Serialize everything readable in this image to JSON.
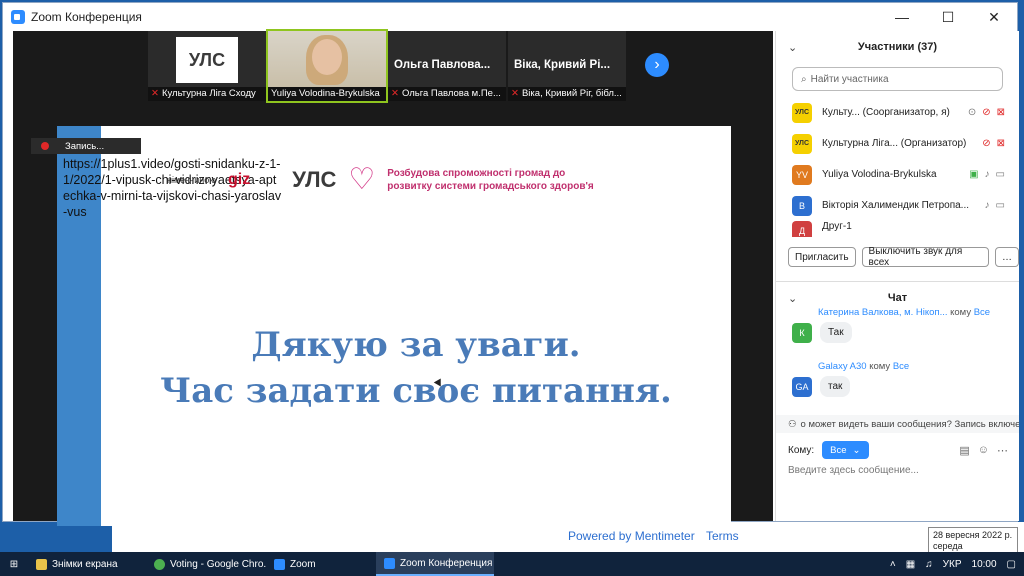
{
  "window": {
    "title": "Zoom Конференция",
    "minimize": "—",
    "maximize": "☐",
    "close": "✕"
  },
  "thumbnails": [
    {
      "name": "Культурна Ліга Сходу",
      "logo_text": "УЛС"
    },
    {
      "name": "Yuliya Volodina-Brykulska"
    },
    {
      "big_name": "Ольга Павлова...",
      "name": "Ольга Павлова м.Пе..."
    },
    {
      "big_name": "Віка, Кривий Рі...",
      "name": "Віка, Кривий Ріг, бібл..."
    }
  ],
  "recording": {
    "label": "Запись..."
  },
  "slide": {
    "url": "https://1plus1.video/gosti-snidanku-z-1-1/2022/1-vipusk-chi-vidriznyaetsya-aptechka-v-mirni-ta-vijskovi-chasi-yaroslav-vus",
    "partner_text": "німеччиною",
    "giz": "giz",
    "logo_text": "УЛС",
    "project_title": "Розбудова спроможності громад до розвитку системи громадського здоров'я",
    "line1": "Дякую за уваги.",
    "line2": "Час задати своє питання."
  },
  "participants_panel": {
    "header": "Участники (37)",
    "search_placeholder": "Найти участника",
    "items": [
      {
        "initials": "УЛС",
        "name": "Культу... (Соорганизатор, я)",
        "color": "#f5d000"
      },
      {
        "initials": "УЛС",
        "name": "Культурна Ліга... (Организатор)",
        "color": "#f5d000"
      },
      {
        "initials": "YV",
        "name": "Yuliya Volodina-Brykulska",
        "color": "#e07a1f"
      },
      {
        "initials": "В",
        "name": "Вікторія Халимендик Петропа...",
        "color": "#2d6fd0"
      },
      {
        "initials": "Д",
        "name": "Друг-1",
        "color": "#d04040"
      }
    ],
    "invite_button": "Пригласить",
    "mute_all_button": "Выключить звук для всех",
    "more_button": "…"
  },
  "chat": {
    "header": "Чат",
    "messages": [
      {
        "from": "Катерина Валкова, м. Нікоп...",
        "to_prefix": "кому",
        "to": "Все",
        "initial": "К",
        "text": "Так",
        "color": "#3fb04a"
      },
      {
        "from": "Galaxy A30",
        "to_prefix": "кому",
        "to": "Все",
        "initial": "GA",
        "text": "так",
        "color": "#2d6fd0"
      }
    ],
    "notice": "о может видеть ваши сообщения? Запись включе",
    "to_label": "Кому:",
    "to_value": "Все",
    "input_placeholder": "Введите здесь сообщение..."
  },
  "mentimeter": {
    "powered": "Powered by Mentimeter",
    "terms": "Terms"
  },
  "date_tooltip": {
    "date": "28 вересня 2022 р.",
    "day": "середа"
  },
  "taskbar": {
    "items": [
      {
        "label": "Знімки екрана",
        "color": "#e8c34a"
      },
      {
        "label": "Voting - Google Chro...",
        "color": "#4caf50"
      },
      {
        "label": "Zoom",
        "color": "#2d8cff"
      },
      {
        "label": "Zoom Конференция",
        "color": "#2d8cff"
      }
    ],
    "lang": "УКР",
    "time": "10:00"
  }
}
